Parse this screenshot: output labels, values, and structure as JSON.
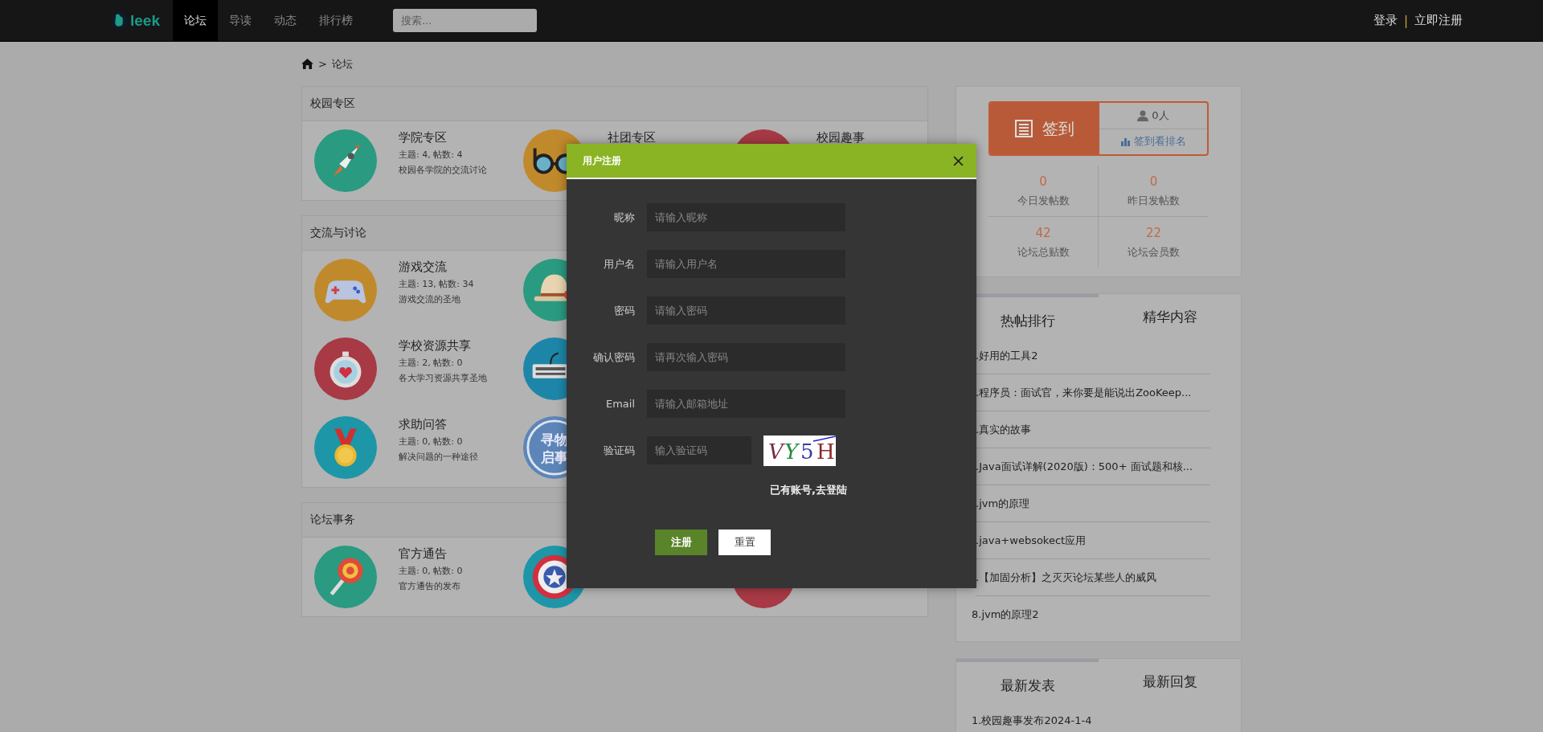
{
  "nav": {
    "logo": "leek",
    "tabs": [
      {
        "label": "论坛",
        "selected": true
      },
      {
        "label": "导读",
        "selected": false
      },
      {
        "label": "动态",
        "selected": false
      },
      {
        "label": "排行榜",
        "selected": false
      }
    ],
    "search": {
      "placeholder": "搜索..."
    },
    "auth": {
      "login": "登录",
      "separator": "|",
      "register": "立即注册"
    }
  },
  "breadcrumb": {
    "separator": ">",
    "current": "论坛"
  },
  "sections": [
    {
      "title": "校园专区",
      "rows": [
        [
          {
            "color": "#2a9a80",
            "title": "学院专区",
            "stats": "主题: 4, 帖数: 4",
            "description": "校园各学院的交流讨论"
          },
          {
            "color": "#c08a2c",
            "title": "社团专区"
          },
          {
            "color": "#a83a45",
            "title": "校园趣事"
          }
        ]
      ]
    },
    {
      "title": "交流与讨论",
      "rows": [
        [
          {
            "color": "#c08a2c",
            "title": "游戏交流",
            "stats": "主题: 13, 帖数: 34",
            "description": "游戏交流的圣地"
          },
          {
            "color": "#2a9a80"
          }
        ],
        [
          {
            "color": "#a83a45",
            "title": "学校资源共享",
            "stats": "主题: 2, 帖数: 0",
            "description": "各大学习资源共享圣地"
          },
          {
            "color": "#1d86a8"
          }
        ],
        [
          {
            "color": "#1d96a8",
            "title": "求助问答",
            "stats": "主题: 0, 帖数: 0",
            "description": "解决问题的一种途径"
          },
          {
            "color": "#5d85b8",
            "stamp_text": [
              "寻物",
              "启事"
            ]
          }
        ]
      ]
    },
    {
      "title": "论坛事务",
      "rows": [
        [
          {
            "color": "#2a9a80",
            "title": "官方通告",
            "stats": "主题: 0, 帖数: 0",
            "description": "官方通告的发布"
          },
          {
            "color": "#1d96a8"
          },
          {
            "color": "#a83a45"
          }
        ]
      ]
    }
  ],
  "checkin": {
    "label": "签到",
    "count": "0人",
    "rank_link": "签到看排名"
  },
  "stats": [
    {
      "value": "0",
      "label": "今日发帖数"
    },
    {
      "value": "0",
      "label": "昨日发帖数"
    },
    {
      "value": "42",
      "label": "论坛总贴数"
    },
    {
      "value": "22",
      "label": "论坛会员数"
    }
  ],
  "hot": {
    "tabs": [
      {
        "label": "热帖排行",
        "selected": true
      },
      {
        "label": "精华内容",
        "selected": false
      }
    ],
    "items": [
      ".好用的工具2",
      ".程序员：面试官，来你要是能说出ZooKeep...",
      ".真实的故事",
      ".Java面试详解(2020版)：500+ 面试题和核...",
      ".jvm的原理",
      ".java+websokect应用",
      ".【加固分析】之灭灭论坛某些人的威风",
      "8.jvm的原理2"
    ]
  },
  "latest": {
    "tabs": [
      {
        "label": "最新发表",
        "selected": true
      },
      {
        "label": "最新回复",
        "selected": false
      }
    ],
    "items": [
      "1.校园趣事发布2024-1-4"
    ]
  },
  "modal": {
    "title": "用户注册",
    "fields": [
      {
        "label": "昵称",
        "placeholder": "请输入昵称",
        "kind": "text"
      },
      {
        "label": "用户名",
        "placeholder": "请输入用户名",
        "kind": "text"
      },
      {
        "label": "密码",
        "placeholder": "请输入密码",
        "kind": "password"
      },
      {
        "label": "确认密码",
        "placeholder": "请再次输入密码",
        "kind": "password"
      },
      {
        "label": "Email",
        "placeholder": "请输入邮箱地址",
        "kind": "text"
      },
      {
        "label": "验证码",
        "placeholder": "输入验证码",
        "kind": "captcha"
      }
    ],
    "captcha": "VY5H",
    "login_link": "已有账号,去登陆",
    "buttons": [
      {
        "label": "注册",
        "kind": "primary"
      },
      {
        "label": "重置",
        "kind": "plain"
      }
    ]
  }
}
